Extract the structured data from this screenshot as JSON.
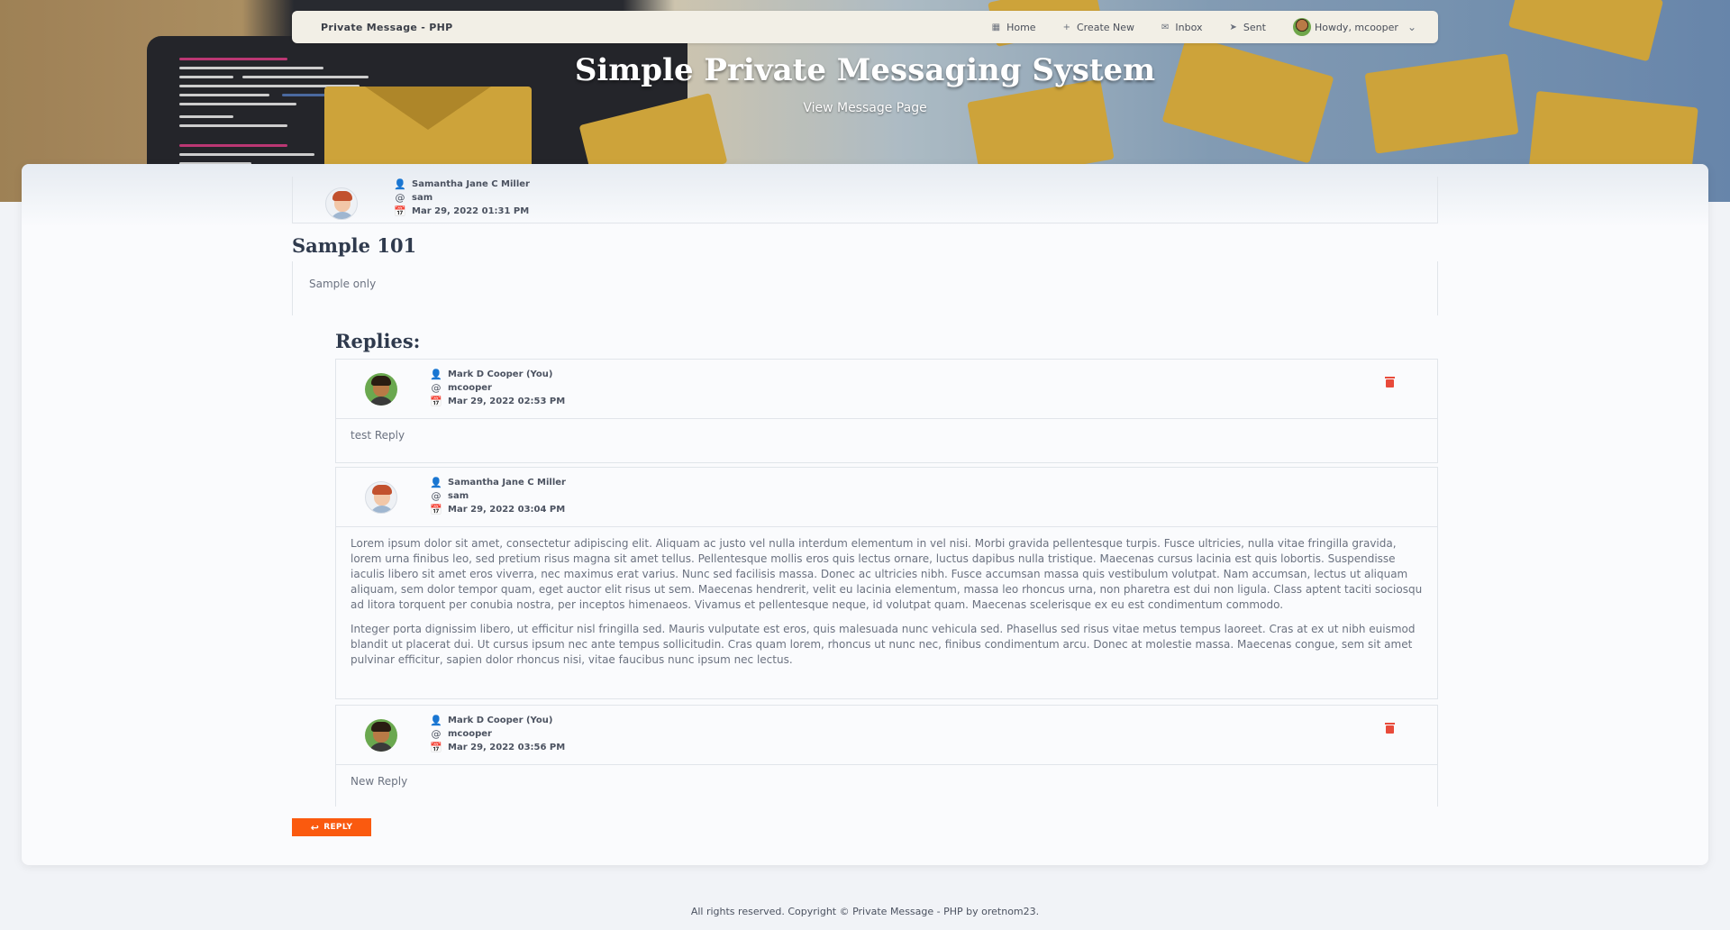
{
  "navbar": {
    "brand": "Private Message - PHP",
    "items": [
      {
        "icon": "grid-icon",
        "glyph": "▦",
        "label": "Home"
      },
      {
        "icon": "plus-icon",
        "glyph": "+",
        "label": "Create New"
      },
      {
        "icon": "inbox-icon",
        "glyph": "✉",
        "label": "Inbox"
      },
      {
        "icon": "send-icon",
        "glyph": "➤",
        "label": "Sent"
      }
    ],
    "user_label": "Howdy, mcooper",
    "user_chevron": "⌄"
  },
  "hero": {
    "title": "Simple Private Messaging System",
    "subtitle": "View Message Page"
  },
  "message": {
    "sender_name": "Samantha Jane C Miller",
    "sender_username": "sam",
    "date": "Mar 29, 2022 01:31 PM",
    "subject": "Sample 101",
    "body": "Sample only"
  },
  "replies_title": "Replies:",
  "replies": [
    {
      "name": "Mark D Cooper (You)",
      "username": "mcooper",
      "date": "Mar 29, 2022 02:53 PM",
      "paragraphs": [
        "test Reply"
      ]
    },
    {
      "name": "Samantha Jane C Miller",
      "username": "sam",
      "date": "Mar 29, 2022 03:04 PM",
      "paragraphs": [
        "Lorem ipsum dolor sit amet, consectetur adipiscing elit. Aliquam ac justo vel nulla interdum elementum in vel nisi. Morbi gravida pellentesque turpis. Fusce ultricies, nulla vitae fringilla gravida, lorem urna finibus leo, sed pretium risus magna sit amet tellus. Pellentesque mollis eros quis lectus ornare, luctus dapibus nulla tristique. Maecenas cursus lacinia est quis lobortis. Suspendisse iaculis libero sit amet eros viverra, nec maximus erat varius. Nunc sed facilisis massa. Donec ac ultricies nibh. Fusce accumsan massa quis vestibulum volutpat. Nam accumsan, lectus ut aliquam aliquam, sem dolor tempor quam, eget auctor elit risus ut sem. Maecenas hendrerit, velit eu lacinia elementum, massa leo rhoncus urna, non pharetra est dui non ligula. Class aptent taciti sociosqu ad litora torquent per conubia nostra, per inceptos himenaeos. Vivamus et pellentesque neque, id volutpat quam. Maecenas scelerisque ex eu est condimentum commodo.",
        "Integer porta dignissim libero, ut efficitur nisl fringilla sed. Mauris vulputate est eros, quis malesuada nunc vehicula sed. Phasellus sed risus vitae metus tempus laoreet. Cras at ex ut nibh euismod blandit ut placerat dui. Ut cursus ipsum nec ante tempus sollicitudin. Cras quam lorem, rhoncus ut nunc nec, finibus condimentum arcu. Donec at molestie massa. Maecenas congue, sem sit amet pulvinar efficitur, sapien dolor rhoncus nisi, vitae faucibus nunc ipsum nec lectus."
      ]
    },
    {
      "name": "Mark D Cooper (You)",
      "username": "mcooper",
      "date": "Mar 29, 2022 03:56 PM",
      "paragraphs": [
        "New Reply"
      ]
    }
  ],
  "reply_button": {
    "icon": "reply-icon",
    "glyph": "↩",
    "label": "REPLY"
  },
  "footer": "All rights reserved. Copyright © Private Message - PHP by oretnom23.",
  "icons": {
    "user": "👤",
    "at": "@",
    "calendar": "📅"
  },
  "colors": {
    "accent": "#fa5a0f",
    "delete": "#e84a3a",
    "heading": "#2f3a4d"
  }
}
